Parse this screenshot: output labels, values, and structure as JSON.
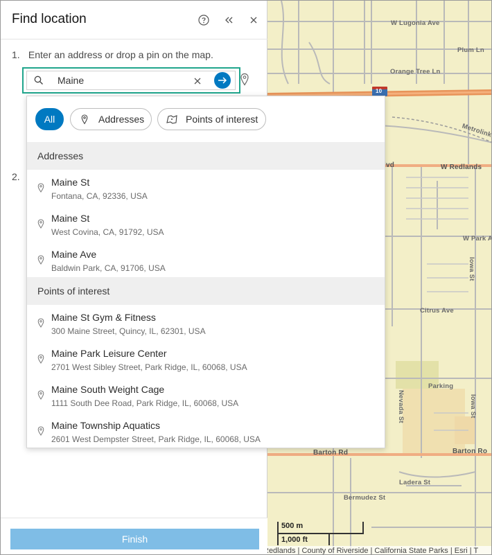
{
  "panel": {
    "title": "Find location",
    "step1_num": "1.",
    "step1_text": "Enter an address or drop a pin on the map.",
    "step2_num": "2."
  },
  "search": {
    "value": "Maine",
    "placeholder": ""
  },
  "filters": {
    "all": "All",
    "addresses": "Addresses",
    "poi": "Points of interest"
  },
  "sections": {
    "addresses": "Addresses",
    "poi": "Points of interest"
  },
  "addresses": [
    {
      "name": "Maine St",
      "detail": "Fontana, CA, 92336, USA"
    },
    {
      "name": "Maine St",
      "detail": "West Covina, CA, 91792, USA"
    },
    {
      "name": "Maine Ave",
      "detail": "Baldwin Park, CA, 91706, USA"
    }
  ],
  "poi": [
    {
      "name": "Maine St Gym & Fitness",
      "detail": "300 Maine Street, Quincy, IL, 62301, USA"
    },
    {
      "name": "Maine Park Leisure Center",
      "detail": "2701 West Sibley Street, Park Ridge, IL, 60068, USA"
    },
    {
      "name": "Maine South Weight Cage",
      "detail": "1111 South Dee Road, Park Ridge, IL, 60068, USA"
    },
    {
      "name": "Maine Township Aquatics",
      "detail": "2601 West Dempster Street, Park Ridge, IL, 60068, USA"
    }
  ],
  "footer": {
    "finish": "Finish"
  },
  "map": {
    "streets": {
      "lugonia": "W Lugonia Ave",
      "plum": "Plum Ln",
      "orange_tree": "Orange Tree Ln",
      "interstate": "10",
      "metrolink": "Metrolink",
      "blvd": "lvd",
      "redlands": "W Redlands",
      "park": "W Park Av",
      "iowa": "Iowa St",
      "citrus": "Citrus Ave",
      "parking": "Parking",
      "nevada": "Nevada St",
      "iowa2": "Iowa St",
      "barton": "Barton Rd",
      "barton2": "Barton Ro",
      "ladera": "Ladera St",
      "bermudez": "Bermudez St"
    },
    "scale_m": "500 m",
    "scale_ft": "1,000 ft",
    "attribution": "Redlands | County of Riverside | California State Parks | Esri | T"
  },
  "colors": {
    "accent": "#0079c1",
    "focus_border": "#1fa58c",
    "finish_disabled": "#7fbde6",
    "map_bg": "#f3efc8",
    "highway": "#e8945a"
  }
}
